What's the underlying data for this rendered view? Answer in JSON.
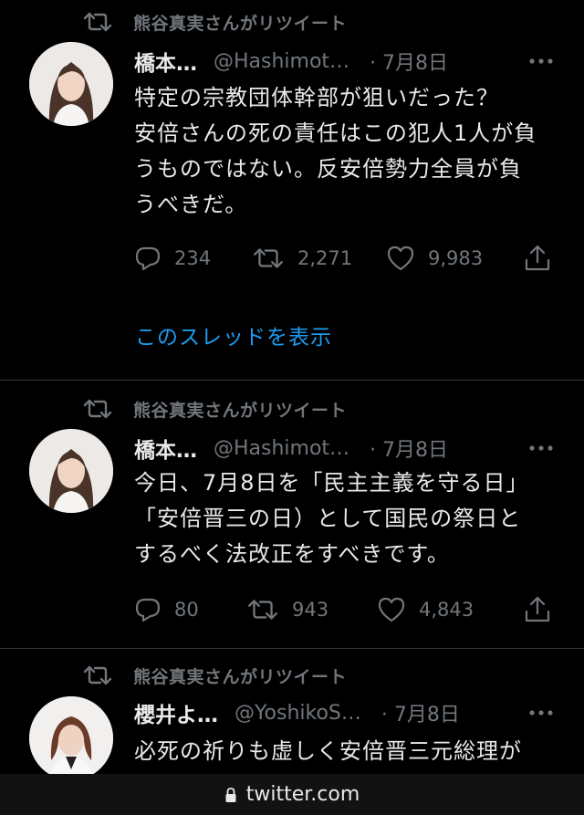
{
  "retweet_label": "熊谷真実さんがリツイート",
  "tweets": [
    {
      "name": "橋本…",
      "handle": "@Hashimot…",
      "date": "· 7月8日",
      "lines": [
        "特定の宗教団体幹部が狙いだった？",
        "安倍さんの死の責任はこの犯人1人が負",
        "うものではない。反安倍勢力全員が負",
        "うべきだ。"
      ],
      "replies": "234",
      "retweets": "2,271",
      "likes": "9,983",
      "thread_link": "このスレッドを表示"
    },
    {
      "name": "橋本…",
      "handle": "@Hashimot…",
      "date": "· 7月8日",
      "lines": [
        "今日、7月8日を「民主主義を守る日」",
        "「安倍晋三の日）として国民の祭日と",
        "するべく法改正をすべきです。"
      ],
      "replies": "80",
      "retweets": "943",
      "likes": "4,843"
    },
    {
      "name": "櫻井よ…",
      "handle": "@YoshikoS…",
      "date": "· 7月8日",
      "lines": [
        "必死の祈りも虚しく安倍晋三元総理が"
      ]
    }
  ],
  "url_bar": {
    "domain": "twitter.com"
  },
  "icons": [
    "retweet-icon",
    "more-icon",
    "reply-icon",
    "like-icon",
    "share-icon",
    "lock-icon"
  ],
  "colors": {
    "background": "#000000",
    "text": "#e7e9ea",
    "secondary": "#71767b",
    "link": "#1d9bf0",
    "divider": "#2f3336"
  }
}
